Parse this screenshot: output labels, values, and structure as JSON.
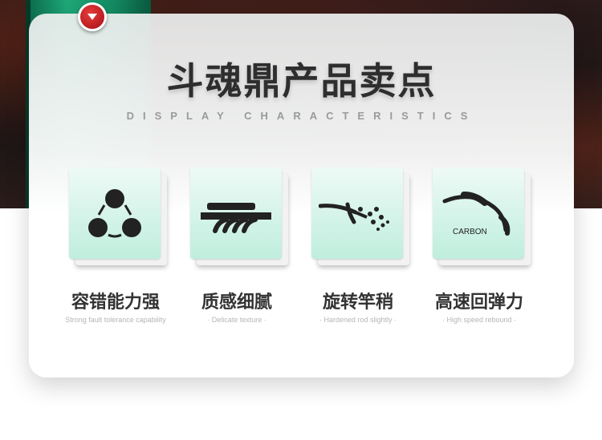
{
  "header": {
    "title": "斗魂鼎产品卖点",
    "subtitle": "DISPLAY CHARACTERISTICS"
  },
  "features": [
    {
      "icon": "three-circles-icon",
      "title": "容错能力强",
      "desc": "Strong fault tolerance capability"
    },
    {
      "icon": "twisted-rope-icon",
      "title": "质感细腻",
      "desc": "· Delicate texture ·"
    },
    {
      "icon": "rod-tip-spray-icon",
      "title": "旋转竿稍",
      "desc": "· Hardened rod slightly ·"
    },
    {
      "icon": "carbon-bend-icon",
      "title": "高速回弹力",
      "desc": "· High speed rebound ·",
      "icon_label": "CARBON"
    }
  ],
  "colors": {
    "accent_red": "#c8161d",
    "tile_green": "#bfeedd",
    "rod_green": "#1ea878",
    "title_text": "#2e2e2e"
  }
}
